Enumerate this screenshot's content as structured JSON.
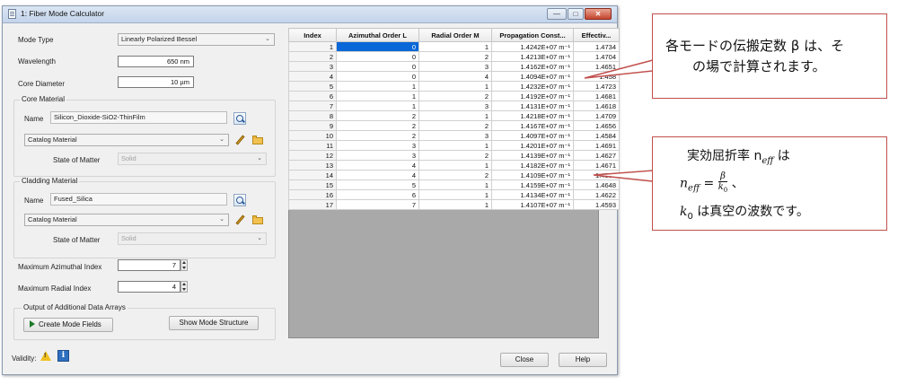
{
  "window": {
    "title": "1: Fiber Mode Calculator",
    "minimize_glyph": "—",
    "maximize_glyph": "□",
    "close_glyph": "✕"
  },
  "form": {
    "mode_type_label": "Mode Type",
    "mode_type_value": "Linearly Polarized Bessel",
    "wavelength_label": "Wavelength",
    "wavelength_value": "650 nm",
    "core_diameter_label": "Core Diameter",
    "core_diameter_value": "10 µm",
    "core_material": {
      "group_title": "Core Material",
      "name_label": "Name",
      "name_value": "Silicon_Dioxide-SiO2-ThinFilm",
      "catalog_value": "Catalog Material",
      "state_label": "State of Matter",
      "state_value": "Solid"
    },
    "cladding_material": {
      "group_title": "Cladding Material",
      "name_label": "Name",
      "name_value": "Fused_Silica",
      "catalog_value": "Catalog Material",
      "state_label": "State of Matter",
      "state_value": "Solid"
    },
    "max_azimuthal_label": "Maximum Azimuthal Index",
    "max_azimuthal_value": "7",
    "max_radial_label": "Maximum Radial Index",
    "max_radial_value": "4",
    "output_group_title": "Output of Additional Data Arrays",
    "create_mode_fields_label": "Create Mode Fields",
    "show_mode_structure_label": "Show Mode Structure"
  },
  "footer": {
    "validity_label": "Validity:",
    "close_label": "Close",
    "help_label": "Help",
    "warning_icon": "warning-icon",
    "info_icon": "info-icon",
    "info_glyph": "i"
  },
  "table": {
    "headers": [
      "Index",
      "Azimuthal Order L",
      "Radial Order M",
      "Propagation Const...",
      "Effectiv..."
    ],
    "rows": [
      [
        "1",
        "0",
        "1",
        "1.4242E+07 m⁻¹",
        "1.4734"
      ],
      [
        "2",
        "0",
        "2",
        "1.4213E+07 m⁻¹",
        "1.4704"
      ],
      [
        "3",
        "0",
        "3",
        "1.4162E+07 m⁻¹",
        "1.4651"
      ],
      [
        "4",
        "0",
        "4",
        "1.4094E+07 m⁻¹",
        "1.458"
      ],
      [
        "5",
        "1",
        "1",
        "1.4232E+07 m⁻¹",
        "1.4723"
      ],
      [
        "6",
        "1",
        "2",
        "1.4192E+07 m⁻¹",
        "1.4681"
      ],
      [
        "7",
        "1",
        "3",
        "1.4131E+07 m⁻¹",
        "1.4618"
      ],
      [
        "8",
        "2",
        "1",
        "1.4218E+07 m⁻¹",
        "1.4709"
      ],
      [
        "9",
        "2",
        "2",
        "1.4167E+07 m⁻¹",
        "1.4656"
      ],
      [
        "10",
        "2",
        "3",
        "1.4097E+07 m⁻¹",
        "1.4584"
      ],
      [
        "11",
        "3",
        "1",
        "1.4201E+07 m⁻¹",
        "1.4691"
      ],
      [
        "12",
        "3",
        "2",
        "1.4139E+07 m⁻¹",
        "1.4627"
      ],
      [
        "13",
        "4",
        "1",
        "1.4182E+07 m⁻¹",
        "1.4671"
      ],
      [
        "14",
        "4",
        "2",
        "1.4109E+07 m⁻¹",
        "1.4596"
      ],
      [
        "15",
        "5",
        "1",
        "1.4159E+07 m⁻¹",
        "1.4648"
      ],
      [
        "16",
        "6",
        "1",
        "1.4134E+07 m⁻¹",
        "1.4622"
      ],
      [
        "17",
        "7",
        "1",
        "1.4107E+07 m⁻¹",
        "1.4593"
      ]
    ]
  },
  "callouts": {
    "top_line1": "各モードの伝搬定数 β は、そ",
    "top_line2": "の場で計算されます。",
    "bottom_line1": "実効屈折率 n",
    "bottom_line1_sub": "eff",
    "bottom_line1_tail": " は",
    "formula_n": "n",
    "formula_n_sub": "eff",
    "formula_eq": " = ",
    "formula_num": "β",
    "formula_den": "k",
    "formula_den_sub": "0",
    "formula_tail": " 、",
    "bottom_line3_k": "k",
    "bottom_line3_k_sub": "0",
    "bottom_line3_tail": " は真空の波数です。"
  },
  "colors": {
    "callout_border": "#c0504d",
    "selection": "#0a67d8"
  }
}
